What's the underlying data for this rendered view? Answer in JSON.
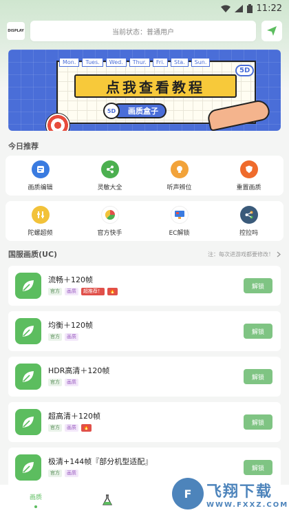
{
  "status_bar": {
    "time": "11:22"
  },
  "header": {
    "logo_text": "DISPLAY",
    "status_label": "当前状态：普通用户"
  },
  "banner": {
    "days": [
      "Mon.",
      "Tues.",
      "Wed.",
      "Thur.",
      "Fri.",
      "Sta.",
      "Sun."
    ],
    "main_text": "点我查看教程",
    "sub_text": "画质盒子",
    "badge": "5D"
  },
  "today": {
    "title": "今日推荐",
    "row1": [
      {
        "label": "画质编辑",
        "color": "#3a7be0",
        "icon": "edit-icon"
      },
      {
        "label": "灵敏大全",
        "color": "#4cb050",
        "icon": "share-icon"
      },
      {
        "label": "听声辨位",
        "color": "#f2a33a",
        "icon": "bulb-icon"
      },
      {
        "label": "重置画质",
        "color": "#ef6b2c",
        "icon": "shield-icon"
      }
    ],
    "row2": [
      {
        "label": "陀螺超频",
        "color": "#f2c23a",
        "icon": "gyro-icon"
      },
      {
        "label": "官方快手",
        "color": "#4cb050",
        "icon": "pie-icon"
      },
      {
        "label": "EC解锁",
        "color": "#3a7be0",
        "icon": "monitor-icon"
      },
      {
        "label": "控拉吗",
        "color": "#3a5a7a",
        "icon": "nodes-icon"
      }
    ]
  },
  "uc": {
    "title": "国服画质(UC)",
    "note": "注：每次进游戏都要修改！",
    "items": [
      {
        "name": "流畅＋120帧",
        "tags": [
          "官方",
          "画质",
          "超推荐！",
          "🔥"
        ],
        "button": "解锁"
      },
      {
        "name": "均衡＋120帧",
        "tags": [
          "官方",
          "画质"
        ],
        "button": "解锁"
      },
      {
        "name": "HDR高清＋120帧",
        "tags": [
          "官方",
          "画质"
        ],
        "button": "解锁"
      },
      {
        "name": "超高清＋120帧",
        "tags": [
          "官方",
          "画质",
          "🔥"
        ],
        "button": "解锁"
      },
      {
        "name": "极清+144帧『部分机型适配』",
        "tags": [
          "官方",
          "画质"
        ],
        "button": "解锁"
      }
    ]
  },
  "bottom_nav": {
    "tab1": "画质"
  },
  "watermark": {
    "big": "飞翔下载",
    "small": "WWW.FXXZ.COM",
    "logo": "F"
  },
  "colors": {
    "accent": "#5cbd5f",
    "button": "#7fc483"
  }
}
